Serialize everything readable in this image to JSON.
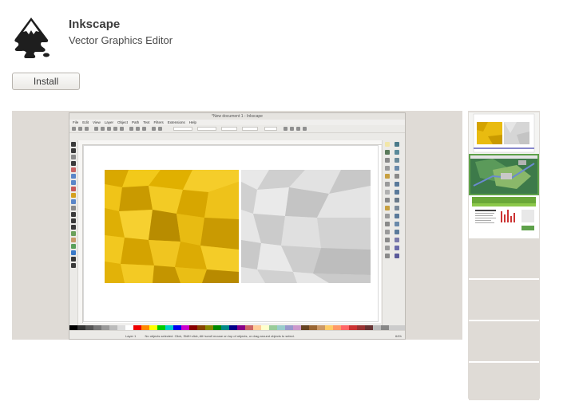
{
  "app": {
    "name": "Inkscape",
    "summary": "Vector Graphics Editor",
    "install_label": "Install",
    "icon": "inkscape-logo-icon"
  },
  "screenshot": {
    "window_title": "*New document 1 - Inkscape",
    "menu": [
      "File",
      "Edit",
      "View",
      "Layer",
      "Object",
      "Path",
      "Text",
      "Filters",
      "Extensions",
      "Help"
    ],
    "status_text": "No objects selected. Click, Shift+click, Alt+scroll mouse on top of objects, or drag around objects to select.",
    "layer_label": "Layer 1",
    "zoom": "64%"
  },
  "thumbnails": [
    {
      "name": "thumbnail-1-polygons"
    },
    {
      "name": "thumbnail-2-map"
    },
    {
      "name": "thumbnail-3-website"
    }
  ],
  "colors": {
    "accent_selected": "#5ea14a",
    "yellow": "#e6b800",
    "grey": "#dcdcdc"
  }
}
